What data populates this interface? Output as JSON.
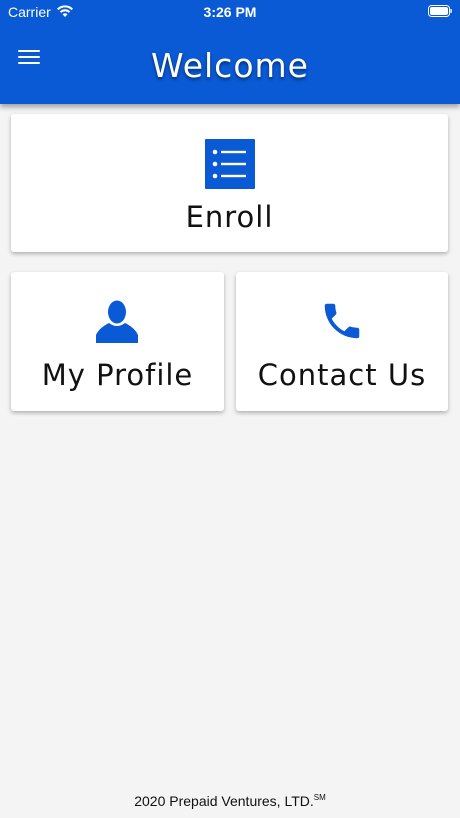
{
  "status_bar": {
    "carrier": "Carrier",
    "time": "3:26 PM",
    "icons": [
      "wifi-icon",
      "battery-icon"
    ]
  },
  "header": {
    "title": "Welcome",
    "menu_icon": "hamburger-menu-icon"
  },
  "tiles": {
    "enroll": {
      "label": "Enroll",
      "icon": "list-icon"
    },
    "profile": {
      "label": "My Profile",
      "icon": "person-icon"
    },
    "contact": {
      "label": "Contact Us",
      "icon": "phone-icon"
    }
  },
  "footer": {
    "text": "2020 Prepaid Ventures, LTD.",
    "mark": "SM"
  },
  "colors": {
    "brand_blue": "#0a5ad6",
    "background": "#f4f4f4",
    "card": "#ffffff"
  }
}
